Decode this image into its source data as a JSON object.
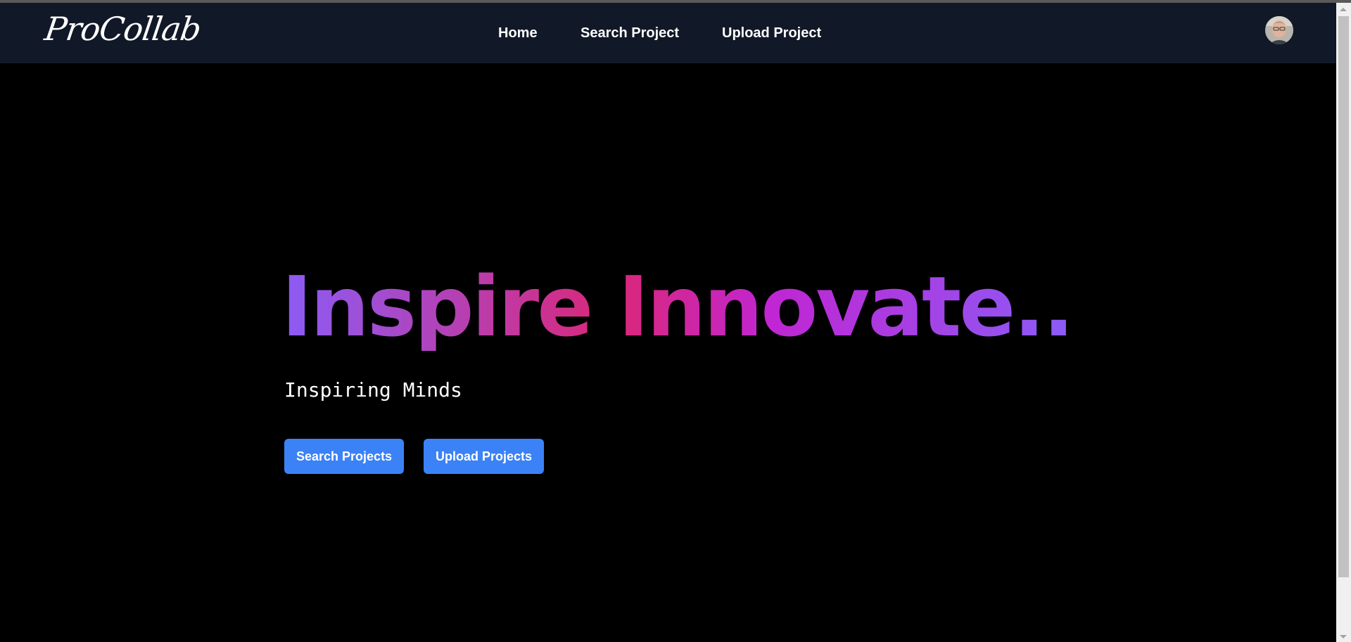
{
  "brand": {
    "logo_text": "ProCollab"
  },
  "nav": {
    "items": [
      {
        "label": "Home"
      },
      {
        "label": "Search Project"
      },
      {
        "label": "Upload Project"
      }
    ]
  },
  "user": {
    "avatar_icon": "user-avatar-photo"
  },
  "hero": {
    "title": "Inspire Innovate..",
    "subtitle": "Inspiring Minds",
    "buttons": [
      {
        "label": "Search Projects"
      },
      {
        "label": "Upload Projects"
      }
    ]
  },
  "colors": {
    "navbar_bg": "#111827",
    "page_bg": "#000000",
    "button_bg": "#3b82f6",
    "gradient_start": "#8b5cf6",
    "gradient_mid": "#db2777",
    "gradient_end": "#8b5cf6"
  }
}
